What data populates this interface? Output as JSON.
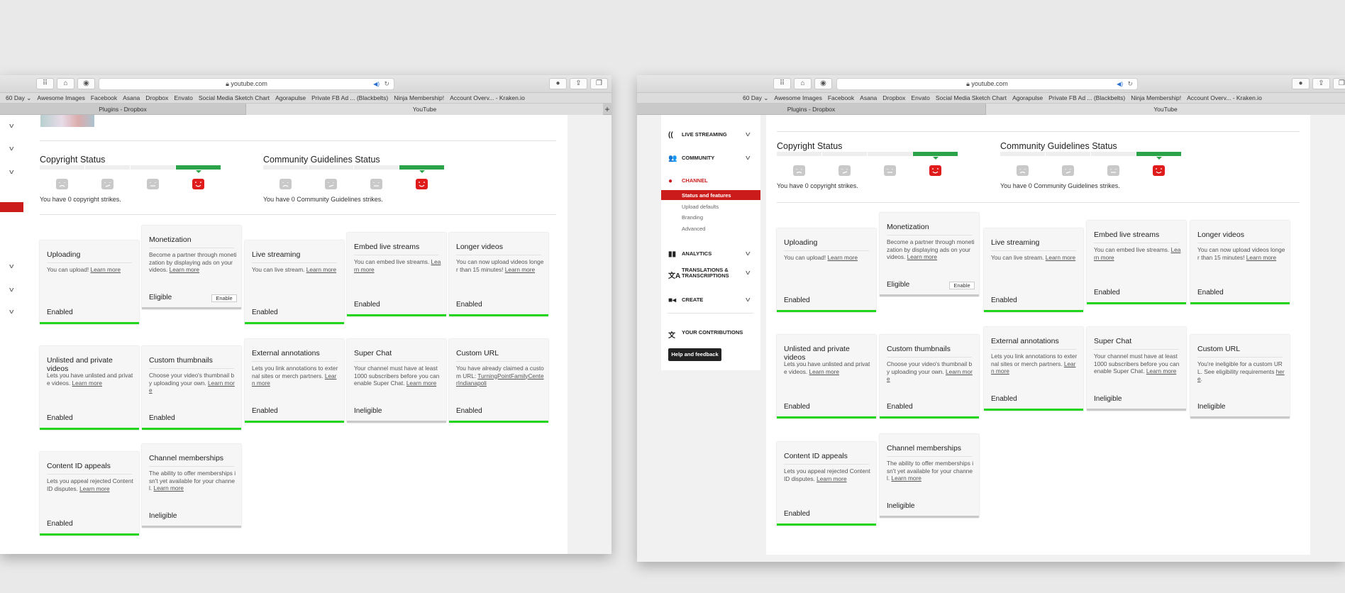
{
  "browser": {
    "url": "youtube.com",
    "bookmarks": [
      "60 Day ⌄",
      "Awesome Images",
      "Facebook",
      "Asana",
      "Dropbox",
      "Envato",
      "Social Media Sketch Chart",
      "Agorapulse",
      "Private FB Ad ... (Blackbelts)",
      "Ninja Membership!",
      "Account Overv... - Kraken.io"
    ],
    "tabs": [
      "Plugins - Dropbox",
      "YouTube"
    ],
    "new_tab": "+"
  },
  "status": {
    "copyright_title": "Copyright Status",
    "copyright_text": "You have 0 copyright strikes.",
    "community_title": "Community Guidelines Status",
    "community_text": "You have 0 Community Guidelines strikes.",
    "strike_level": 0,
    "colors": {
      "ok": "#2aa349",
      "face_active": "#e01b1b",
      "enabled": "#22d41c"
    }
  },
  "sidebar": {
    "items": [
      {
        "label": "LIVE STREAMING",
        "icon": "live-streaming-icon"
      },
      {
        "label": "COMMUNITY",
        "icon": "community-icon"
      },
      {
        "label": "CHANNEL",
        "icon": "channel-icon"
      },
      {
        "label": "ANALYTICS",
        "icon": "analytics-icon"
      },
      {
        "label": "TRANSLATIONS &",
        "label2": "TRANSCRIPTIONS",
        "icon": "translate-icon"
      },
      {
        "label": "CREATE",
        "icon": "create-icon"
      },
      {
        "label": "YOUR CONTRIBUTIONS",
        "icon": "contributions-icon"
      }
    ],
    "channel_sub": [
      "Status and features",
      "Upload defaults",
      "Branding",
      "Advanced"
    ],
    "active_sub": "Status and features",
    "help": "Help and feedback"
  },
  "left_cards": [
    {
      "title": "Uploading",
      "desc": "You can upload! ",
      "link": "Learn more",
      "status": "Enabled"
    },
    {
      "title": "Monetization",
      "desc": "Become a partner through monetization by displaying ads on your videos. ",
      "link": "Learn more",
      "status": "Eligible",
      "button": "Enable"
    },
    {
      "title": "Live streaming",
      "desc": "You can live stream. ",
      "link": "Learn more",
      "status": "Enabled"
    },
    {
      "title": "Embed live streams",
      "desc": "You can embed live streams. ",
      "link": "Learn more",
      "status": "Enabled"
    },
    {
      "title": "Longer videos",
      "desc": "You can now upload videos longer than 15 minutes! ",
      "link": "Learn more",
      "status": "Enabled"
    },
    {
      "title": "Unlisted and private videos",
      "desc": "Lets you have unlisted and private videos. ",
      "link": "Learn more",
      "status": "Enabled"
    },
    {
      "title": "Custom thumbnails",
      "desc": "Choose your video's thumbnail by uploading your own. ",
      "link": "Learn more",
      "status": "Enabled"
    },
    {
      "title": "External annotations",
      "desc": "Lets you link annotations to external sites or merch partners. ",
      "link": "Learn more",
      "status": "Enabled"
    },
    {
      "title": "Super Chat",
      "desc": "Your channel must have at least 1000 subscribers before you can enable Super Chat. ",
      "link": "Learn more",
      "status": "Ineligible"
    },
    {
      "title": "Custom URL",
      "desc": "You have already claimed a custom URL: ",
      "link": "TurningPointFamilyCenterIndianapoli",
      "status": "Enabled"
    },
    {
      "title": "Content ID appeals",
      "desc": "Lets you appeal rejected Content ID disputes. ",
      "link": "Learn more",
      "status": "Enabled"
    },
    {
      "title": "Channel memberships",
      "desc": "The ability to offer memberships isn't yet available for your channel. ",
      "link": "Learn more",
      "status": "Ineligible"
    }
  ],
  "right_cards": [
    {
      "title": "Uploading",
      "desc": "You can upload! ",
      "link": "Learn more",
      "status": "Enabled"
    },
    {
      "title": "Monetization",
      "desc": "Become a partner through monetization by displaying ads on your videos. ",
      "link": "Learn more",
      "status": "Eligible",
      "button": "Enable"
    },
    {
      "title": "Live streaming",
      "desc": "You can live stream. ",
      "link": "Learn more",
      "status": "Enabled"
    },
    {
      "title": "Embed live streams",
      "desc": "You can embed live streams. ",
      "link": "Learn more",
      "status": "Enabled"
    },
    {
      "title": "Longer videos",
      "desc": "You can now upload videos longer than 15 minutes! ",
      "link": "Learn more",
      "status": "Enabled"
    },
    {
      "title": "Unlisted and private videos",
      "desc": "Lets you have unlisted and private videos. ",
      "link": "Learn more",
      "status": "Enabled"
    },
    {
      "title": "Custom thumbnails",
      "desc": "Choose your video's thumbnail by uploading your own. ",
      "link": "Learn more",
      "status": "Enabled"
    },
    {
      "title": "External annotations",
      "desc": "Lets you link annotations to external sites or merch partners. ",
      "link": "Learn more",
      "status": "Enabled"
    },
    {
      "title": "Super Chat",
      "desc": "Your channel must have at least 1000 subscribers before you can enable Super Chat. ",
      "link": "Learn more",
      "status": "Ineligible"
    },
    {
      "title": "Custom URL",
      "desc": "You're ineligible for a custom URL. See eligibility requirements ",
      "link": "here",
      "after": ".",
      "status": "Ineligible"
    },
    {
      "title": "Content ID appeals",
      "desc": "Lets you appeal rejected Content ID disputes. ",
      "link": "Learn more",
      "status": "Enabled"
    },
    {
      "title": "Channel memberships",
      "desc": "The ability to offer memberships isn't yet available for your channel. ",
      "link": "Learn more",
      "status": "Ineligible"
    }
  ]
}
